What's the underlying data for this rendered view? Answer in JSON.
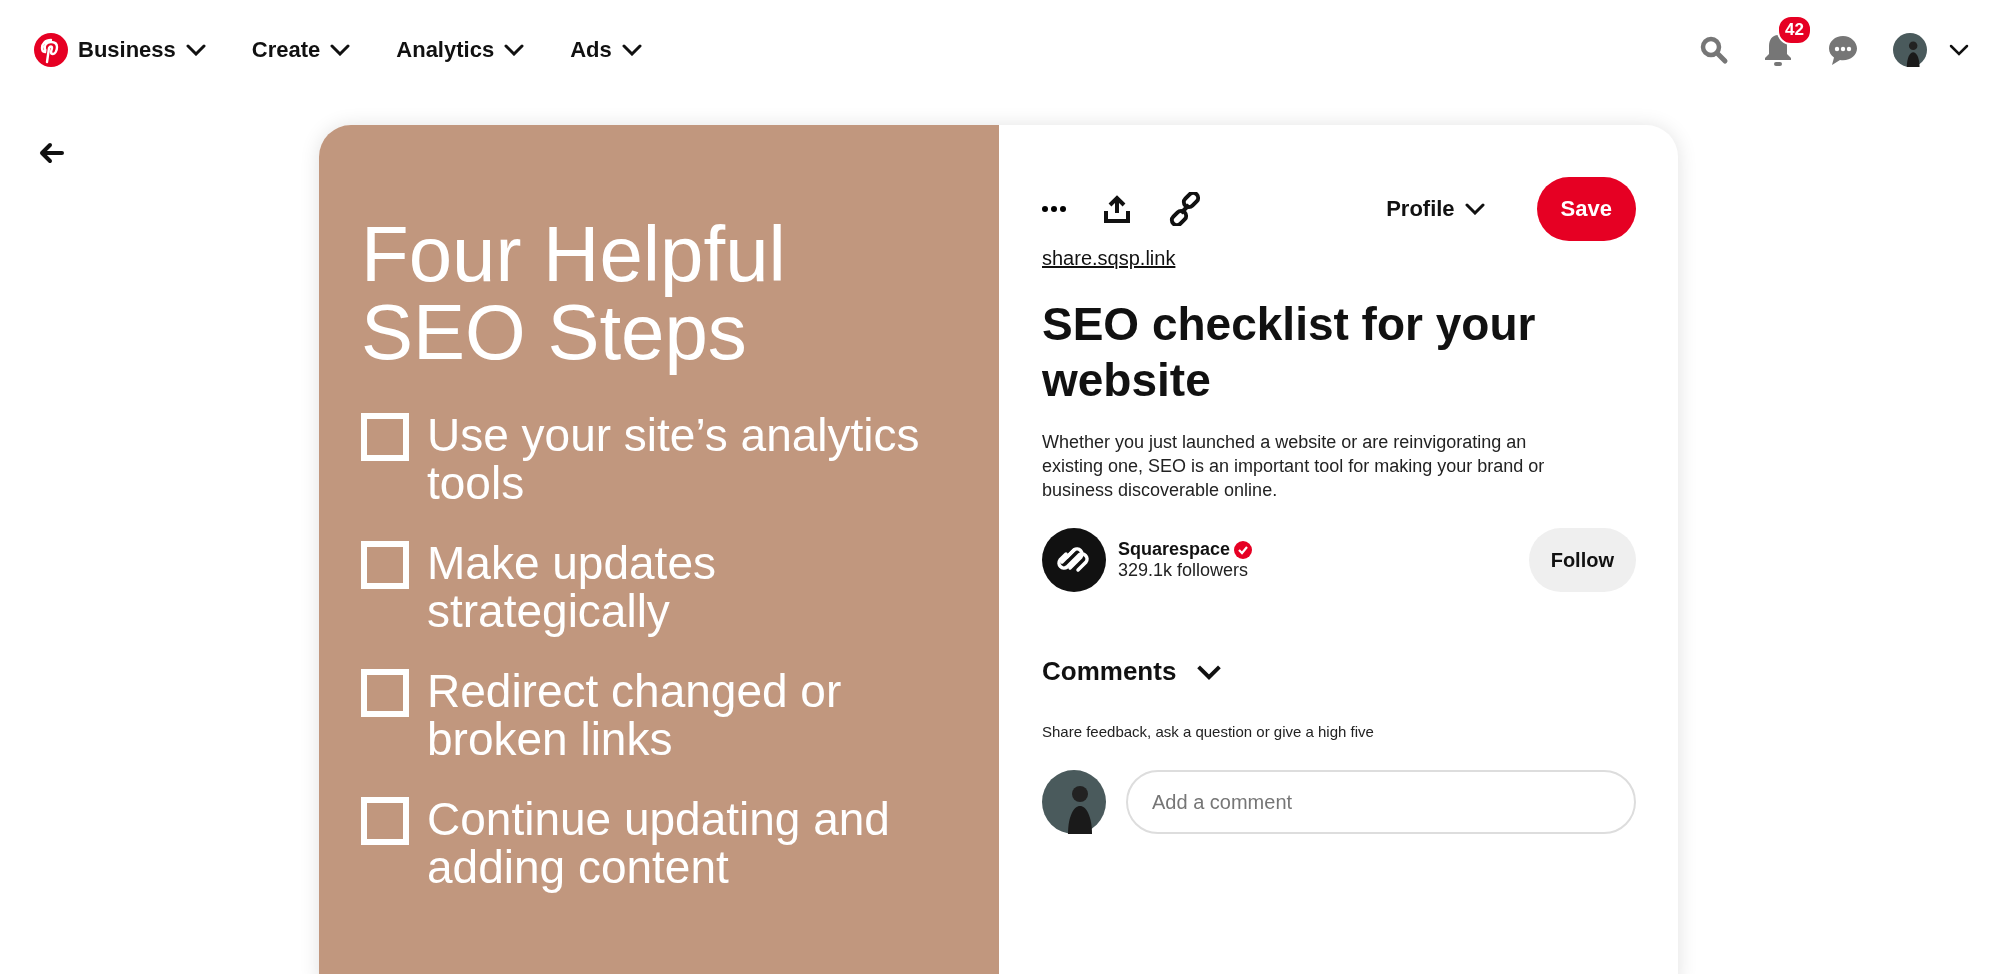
{
  "nav": {
    "menus": [
      {
        "label": "Business"
      },
      {
        "label": "Create"
      },
      {
        "label": "Analytics"
      },
      {
        "label": "Ads"
      }
    ],
    "notifications": "42"
  },
  "pin_image": {
    "title": "Four Helpful SEO Steps",
    "checklist": [
      {
        "text": "Use your site’s analytics tools",
        "checked": false
      },
      {
        "text": "Make updates strategically",
        "checked": false
      },
      {
        "text": "Redirect changed or broken links",
        "checked": false
      },
      {
        "text": "Continue updating and adding content",
        "checked": false
      }
    ]
  },
  "pin": {
    "board": "Profile",
    "save": "Save",
    "link": "share.sqsp.link",
    "title": "SEO checklist for your website",
    "description": "Whether you just launched a website or are reinvigorating an existing one, SEO is an important tool for making your brand or business discoverable online.",
    "author": {
      "name": "Squarespace",
      "verified": true,
      "followers": "329.1k followers",
      "follow": "Follow"
    }
  },
  "comments": {
    "heading": "Comments",
    "expanded": true,
    "hint": "Share feedback, ask a question or give a high five",
    "placeholder": "Add a comment"
  }
}
